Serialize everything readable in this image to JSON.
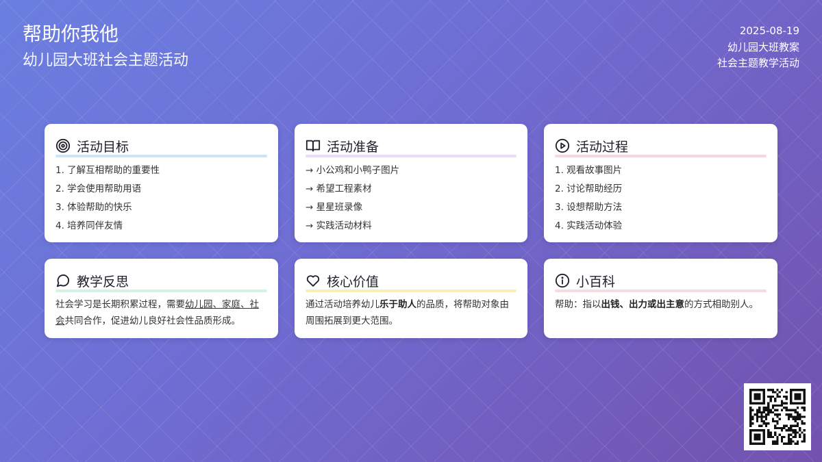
{
  "header": {
    "title": "帮助你我他",
    "subtitle": "幼儿园大班社会主题活动",
    "date": "2025-08-19",
    "meta1": "幼儿园大班教案",
    "meta2": "社会主题教学活动"
  },
  "cards": {
    "goals": {
      "title": "活动目标",
      "accent": "#cfe3f7",
      "items": [
        "1. 了解互相帮助的重要性",
        "2. 学会使用帮助用语",
        "3. 体验帮助的快乐",
        "4. 培养同伴友情"
      ]
    },
    "prep": {
      "title": "活动准备",
      "accent": "#ecdcf7",
      "items": [
        "→ 小公鸡和小鸭子图片",
        "→ 希望工程素材",
        "→ 星星班录像",
        "→ 实践活动材料"
      ]
    },
    "process": {
      "title": "活动过程",
      "accent": "#f8d5e3",
      "items": [
        "1. 观看故事图片",
        "2. 讨论帮助经历",
        "3. 设想帮助方法",
        "4. 实践活动体验"
      ]
    },
    "reflection": {
      "title": "教学反思",
      "accent": "#d4f3e2",
      "text_a": "社会学习是长期积累过程，需要",
      "text_u": "幼儿园、家庭、社会",
      "text_b": "共同合作，促进幼儿良好社会性品质形成。"
    },
    "values": {
      "title": "核心价值",
      "accent": "#f8efb8",
      "text_a": "通过活动培养幼儿",
      "text_bold": "乐于助人",
      "text_b": "的品质，将帮助对象由周围拓展到更大范围。"
    },
    "wiki": {
      "title": "小百科",
      "accent": "#f6dbe1",
      "text_a": "帮助：指以",
      "text_bold": "出钱、出力或出主意",
      "text_b": "的方式相助别人。"
    }
  },
  "icons": {
    "goals": "target-icon",
    "prep": "book-open-icon",
    "process": "play-circle-icon",
    "reflection": "chat-bubble-icon",
    "values": "heart-icon",
    "wiki": "info-icon"
  },
  "colors": {
    "bg_start": "#6a7fe0",
    "bg_end": "#7352ae"
  }
}
